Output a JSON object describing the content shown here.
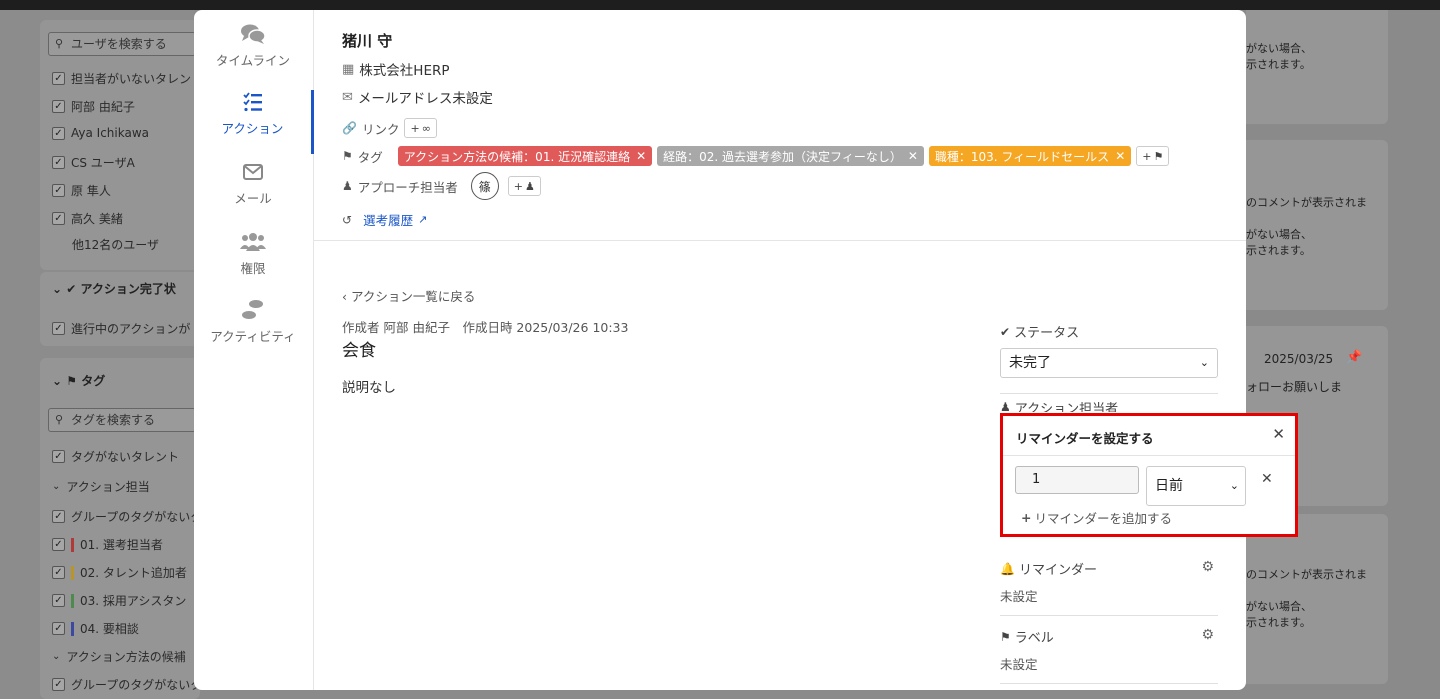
{
  "background": {
    "left_panel": {
      "user_search_placeholder": "ユーザを検索する",
      "users": [
        {
          "label": "担当者がいないタレン"
        },
        {
          "label": "阿部 由紀子"
        },
        {
          "label": "Aya Ichikawa"
        },
        {
          "label": "CS ユーザA"
        },
        {
          "label": "原 隼人"
        },
        {
          "label": "高久 美緒"
        }
      ],
      "more_users": "他12名のユーザ",
      "action_status_heading": "アクション完了状",
      "action_status_option": "進行中のアクションが",
      "tag_heading": "タグ",
      "tag_search_placeholder": "タグを検索する",
      "tag_items": [
        {
          "label": "タグがないタレント"
        },
        {
          "label": "アクション担当",
          "group": true
        },
        {
          "label": "グループのタグがないタ"
        },
        {
          "label": "01. 選考担当者",
          "color": "#b03a3a"
        },
        {
          "label": "02. タレント追加者",
          "color": "#b8952a"
        },
        {
          "label": "03. 採用アシスタン",
          "color": "#4d8a4d"
        },
        {
          "label": "04. 要相談",
          "color": "#3b4aa0"
        },
        {
          "label": "アクション方法の候補",
          "group": true
        },
        {
          "label": "グループのタグがないタ"
        }
      ]
    },
    "right_panel": {
      "text_1": "がない場合、",
      "text_2": "示されます。",
      "text_3": "のコメントが表示されま",
      "text_4": "がない場合、",
      "text_5": "示されます。",
      "date": "2025/03/25",
      "text_6": "ォローお願いしま",
      "text_7": "のコメントが表示されま",
      "text_8": "がない場合、",
      "text_9": "示されます。"
    }
  },
  "nav": [
    {
      "id": "timeline",
      "label": "タイムライン",
      "icon": "comments-icon"
    },
    {
      "id": "action",
      "label": "アクション",
      "icon": "tasks-icon",
      "active": true
    },
    {
      "id": "mail",
      "label": "メール",
      "icon": "envelope-icon"
    },
    {
      "id": "permission",
      "label": "権限",
      "icon": "users-icon"
    },
    {
      "id": "activity",
      "label": "アクティビティ",
      "icon": "footprints-icon"
    }
  ],
  "profile": {
    "name": "猪川 守",
    "company": "株式会社HERP",
    "email": "メールアドレス未設定",
    "link_label": "リンク",
    "tag_label": "タグ",
    "tags": [
      {
        "text": "アクション方法の候補：01. 近況確認連絡",
        "color": "#e05a5a"
      },
      {
        "text": "経路：02. 過去選考参加（決定フィーなし）",
        "color": "#a8a8a8"
      },
      {
        "text": "職種：103. フィールドセールス",
        "color": "#f5a623"
      }
    ],
    "approach_label": "アプローチ担当者",
    "approach_avatar": "篠",
    "history_link": "選考履歴"
  },
  "action": {
    "back_link": "アクション一覧に戻る",
    "meta": "作成者 阿部 由紀子　作成日時 2025/03/26 10:33",
    "title": "会食",
    "description": "説明なし"
  },
  "properties": {
    "status_label": "ステータス",
    "status_value": "未完了",
    "assignee_label": "アクション担当者",
    "reminder_label": "リマインダー",
    "reminder_value": "未設定",
    "label_label": "ラベル",
    "label_value": "未設定"
  },
  "reminder_popover": {
    "title": "リマインダーを設定する",
    "amount": "1",
    "unit": "日前",
    "add_label": "リマインダーを追加する",
    "highlight_color": "#e60000"
  }
}
